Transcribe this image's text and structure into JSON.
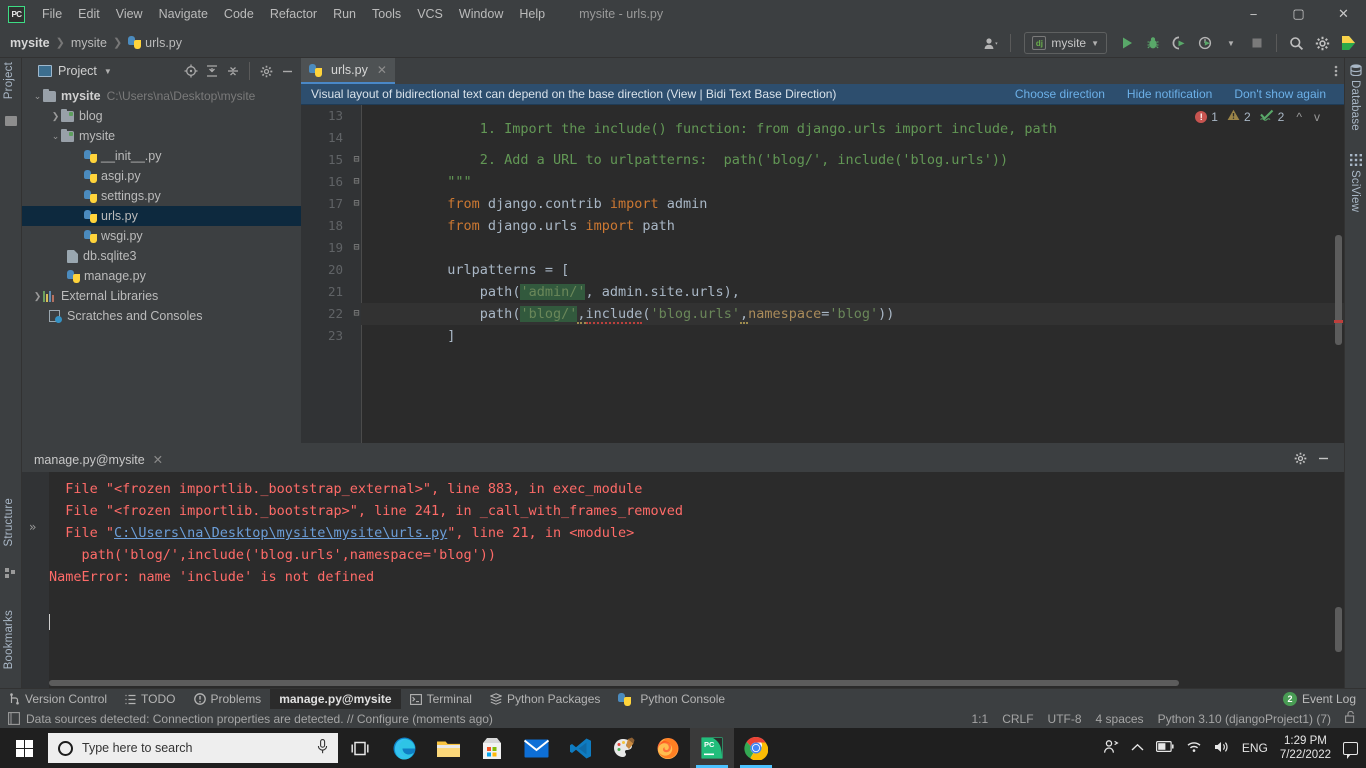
{
  "window": {
    "title": "mysite - urls.py",
    "logo": "pycharm-logo",
    "minimize": "−",
    "maximize": "▢",
    "close": "✕"
  },
  "menu": {
    "items": [
      "File",
      "Edit",
      "View",
      "Navigate",
      "Code",
      "Refactor",
      "Run",
      "Tools",
      "VCS",
      "Window",
      "Help"
    ]
  },
  "breadcrumb": {
    "project": "mysite",
    "package": "mysite",
    "file": "urls.py"
  },
  "toolbar": {
    "account_icon": "user-account-icon",
    "run_config": "mysite",
    "run_config_icon": "dj",
    "run_icon": "run-icon",
    "debug_icon": "debug-bug-icon",
    "coverage_icon": "run-with-coverage-icon",
    "profile_icon": "profile-icon",
    "stop_icon": "stop-icon",
    "search_icon": "search-everywhere-icon",
    "settings_icon": "settings-gear-icon",
    "updates_icon": "toolbox-icon"
  },
  "left_strip": {
    "top_tab": "Project",
    "bottom_tabs": [
      "Structure",
      "Bookmarks"
    ]
  },
  "right_strip": {
    "tabs": [
      "Database",
      "SciView"
    ]
  },
  "project_panel": {
    "title": "Project",
    "icons": [
      "select-opened-file-icon",
      "expand-all-icon",
      "collapse-all-icon",
      "settings-gear-icon",
      "hide-icon"
    ],
    "tree": [
      {
        "label": "mysite",
        "path": "C:\\Users\\na\\Desktop\\mysite",
        "icon": "folder",
        "arrow": "v",
        "indent": 0,
        "bold": true,
        "selected": false
      },
      {
        "label": "blog",
        "path": "",
        "icon": "folder-src",
        "arrow": ">",
        "indent": 1,
        "bold": false,
        "selected": false
      },
      {
        "label": "mysite",
        "path": "",
        "icon": "folder-src",
        "arrow": "v",
        "indent": 1,
        "bold": false,
        "selected": false
      },
      {
        "label": "__init__.py",
        "path": "",
        "icon": "python",
        "arrow": "",
        "indent": 2,
        "bold": false,
        "selected": false
      },
      {
        "label": "asgi.py",
        "path": "",
        "icon": "python",
        "arrow": "",
        "indent": 2,
        "bold": false,
        "selected": false
      },
      {
        "label": "settings.py",
        "path": "",
        "icon": "python",
        "arrow": "",
        "indent": 2,
        "bold": false,
        "selected": false
      },
      {
        "label": "urls.py",
        "path": "",
        "icon": "python",
        "arrow": "",
        "indent": 2,
        "bold": false,
        "selected": true
      },
      {
        "label": "wsgi.py",
        "path": "",
        "icon": "python",
        "arrow": "",
        "indent": 2,
        "bold": false,
        "selected": false
      },
      {
        "label": "db.sqlite3",
        "path": "",
        "icon": "db",
        "arrow": "",
        "indent": 1,
        "bold": false,
        "selected": false
      },
      {
        "label": "manage.py",
        "path": "",
        "icon": "python",
        "arrow": "",
        "indent": 1,
        "bold": false,
        "selected": false
      },
      {
        "label": "External Libraries",
        "path": "",
        "icon": "library",
        "arrow": ">",
        "indent": 0,
        "bold": false,
        "selected": false
      },
      {
        "label": "Scratches and Consoles",
        "path": "",
        "icon": "scratch",
        "arrow": "",
        "indent": 0,
        "bold": false,
        "selected": false
      }
    ]
  },
  "editor": {
    "tab": {
      "label": "urls.py",
      "icon": "python",
      "close": "✕"
    },
    "options_icon": "more-options-icon",
    "notification": {
      "message": "Visual layout of bidirectional text can depend on the base direction (View | Bidi Text Base Direction)",
      "links": [
        "Choose direction",
        "Hide notification",
        "Don't show again"
      ]
    },
    "inspections": {
      "error_count": "1",
      "warning_count": "2",
      "typo_count": "2",
      "error_icon": "error-icon",
      "warning_icon": "warning-icon",
      "typo_icon": "typo-icon",
      "prev_icon": "^",
      "next_icon": "v"
    },
    "lines": [
      {
        "num": "13",
        "fold": "",
        "clipped": true
      },
      {
        "num": "14",
        "fold": "",
        "clipped": false
      },
      {
        "num": "15",
        "fold": "-",
        "clipped": false
      },
      {
        "num": "16",
        "fold": "-",
        "clipped": false
      },
      {
        "num": "17",
        "fold": "-",
        "clipped": false
      },
      {
        "num": "18",
        "fold": "",
        "clipped": false
      },
      {
        "num": "19",
        "fold": "-",
        "clipped": false
      },
      {
        "num": "20",
        "fold": "",
        "clipped": false
      },
      {
        "num": "21",
        "fold": "",
        "clipped": false
      },
      {
        "num": "22",
        "fold": "-",
        "clipped": false
      },
      {
        "num": "23",
        "fold": "",
        "clipped": false
      }
    ],
    "code": {
      "l13": "    1. Import the include() function: from django.urls import include, path",
      "l14": "    2. Add a URL to urlpatterns:  path('blog/', include('blog.urls'))",
      "l15": "\"\"\"",
      "l16_kw": "from",
      "l16_mod": " django.contrib ",
      "l16_import": "import",
      "l16_name": " admin",
      "l17_kw": "from",
      "l17_mod": " django.urls ",
      "l17_import": "import",
      "l17_name": " path",
      "l19": "urlpatterns = [",
      "l20_fn": "path",
      "l20_str1": "'admin/'",
      "l20_rest": ", admin.site.urls),",
      "l21_fn": "path",
      "l21_str1": "'blog/'",
      "l21_comma1": ",",
      "l21_include": "include",
      "l21_paren": "(",
      "l21_str2": "'blog.urls'",
      "l21_comma2": ",",
      "l21_param": "namespace",
      "l21_eq": "=",
      "l21_str3": "'blog'",
      "l21_close": "))",
      "l22": "]"
    }
  },
  "console": {
    "tab": "manage.py@mysite",
    "tab_close": "✕",
    "settings_icon": "settings-gear-icon",
    "minimize_icon": "hide-icon",
    "expand_icon": "»",
    "output": [
      {
        "pre": "  File \"<frozen importlib._bootstrap_external>\", line 883, in exec_module",
        "link": "",
        "post": ""
      },
      {
        "pre": "  File \"<frozen importlib._bootstrap>\", line 241, in _call_with_frames_removed",
        "link": "",
        "post": ""
      },
      {
        "pre": "  File \"",
        "link": "C:\\Users\\na\\Desktop\\mysite\\mysite\\urls.py",
        "post": "\", line 21, in <module>"
      },
      {
        "pre": "    path('blog/',include('blog.urls',namespace='blog'))",
        "link": "",
        "post": ""
      },
      {
        "pre": "NameError: name 'include' is not defined",
        "link": "",
        "post": ""
      }
    ]
  },
  "toolwindow_bar": {
    "items": [
      {
        "label": "Version Control",
        "icon": "branch-icon",
        "active": false
      },
      {
        "label": "TODO",
        "icon": "list-icon",
        "active": false
      },
      {
        "label": "Problems",
        "icon": "problems-icon",
        "active": false
      },
      {
        "label": "manage.py@mysite",
        "icon": "",
        "active": true
      },
      {
        "label": "Terminal",
        "icon": "terminal-icon",
        "active": false
      },
      {
        "label": "Python Packages",
        "icon": "packages-icon",
        "active": false
      },
      {
        "label": "Python Console",
        "icon": "python-console-icon",
        "active": false
      }
    ],
    "event_log": {
      "label": "Event Log",
      "count": "2"
    }
  },
  "status_bar": {
    "icon": "database-icon",
    "message": "Data sources detected: Connection properties are detected. // Configure (moments ago)",
    "caret": "1:1",
    "line_sep": "CRLF",
    "encoding": "UTF-8",
    "indent": "4 spaces",
    "interpreter": "Python 3.10 (djangoProject1) (7)",
    "lock_icon": "unlocked-icon"
  },
  "taskbar": {
    "start_icon": "windows-start-icon",
    "search_placeholder": "Type here to search",
    "search_icon": "cortana-circle-icon",
    "mic_icon": "microphone-icon",
    "apps": [
      {
        "name": "task-view-icon",
        "active": false,
        "running": false
      },
      {
        "name": "microsoft-edge-icon",
        "active": false,
        "running": false
      },
      {
        "name": "file-explorer-icon",
        "active": false,
        "running": false
      },
      {
        "name": "microsoft-store-icon",
        "active": false,
        "running": false
      },
      {
        "name": "mail-icon",
        "active": false,
        "running": false
      },
      {
        "name": "vscode-icon",
        "active": false,
        "running": false
      },
      {
        "name": "paint-3d-icon",
        "active": false,
        "running": false
      },
      {
        "name": "firefox-icon",
        "active": false,
        "running": false
      },
      {
        "name": "pycharm-icon",
        "active": true,
        "running": true
      },
      {
        "name": "google-chrome-icon",
        "active": false,
        "running": true
      }
    ],
    "tray": {
      "people_icon": "people-icon",
      "chevron_icon": "show-hidden-icons-icon",
      "battery_icon": "battery-icon",
      "network_icon": "wifi-icon",
      "volume_icon": "volume-icon",
      "language": "ENG",
      "time": "1:29 PM",
      "date": "7/22/2022",
      "action_center_icon": "action-center-icon"
    }
  }
}
